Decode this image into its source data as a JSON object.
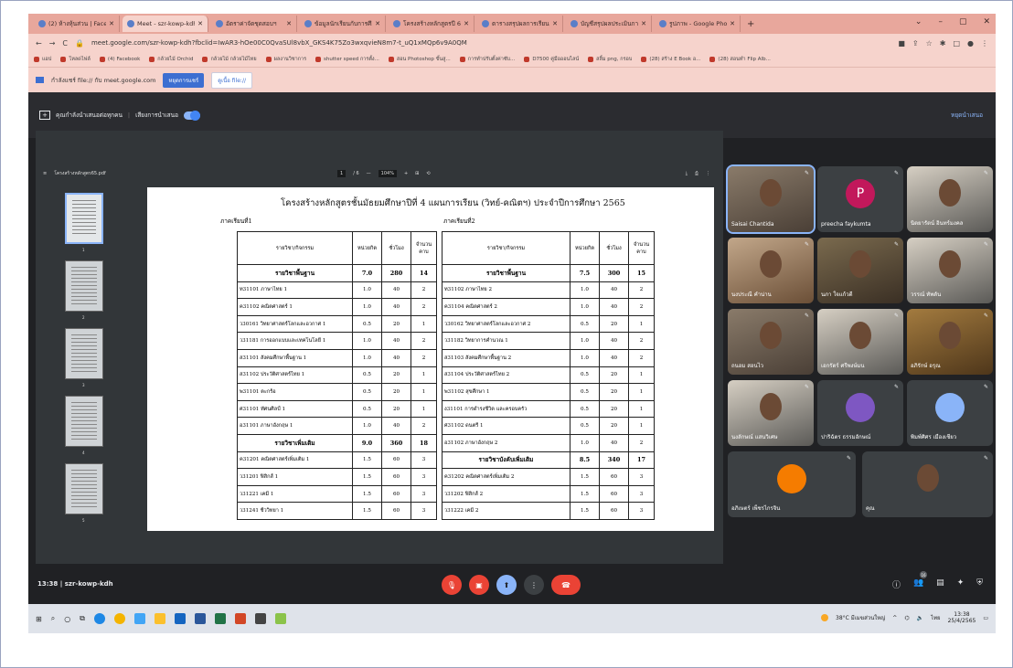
{
  "browser": {
    "tabs": [
      {
        "label": "(2) ห้างหุ้นส่วน | Facebook",
        "icon": "facebook-icon",
        "active": false
      },
      {
        "label": "Meet - szr-kowp-kdh",
        "icon": "meet-icon",
        "active": true
      },
      {
        "label": "อัตราค่าจัดชุดสอบฯ",
        "icon": "chrome-icon",
        "active": false
      },
      {
        "label": "ข้อมูลนักเรียนกับการศึกษา",
        "icon": "chrome-icon",
        "active": false
      },
      {
        "label": "โครงสร้างหลักสูตรปี 65",
        "icon": "chrome-icon",
        "active": false
      },
      {
        "label": "ตารางสรุปผลการเรียน",
        "icon": "chrome-icon",
        "active": false
      },
      {
        "label": "บัญชีสรุปผลประเมินการศึกษา",
        "icon": "chrome-icon",
        "active": false
      },
      {
        "label": "รูปภาพ - Google Photos",
        "icon": "photos-icon",
        "active": false
      }
    ],
    "new_tab": "+",
    "url": "meet.google.com/szr-kowp-kdh?fbclid=IwAR3-hOe00C0QvaSUl8vbX_GKS4K75Zo3wxqvieN8m7-t_uQ1xMQp6v9A0QM",
    "bookmarks": [
      "แอป",
      "โหลดไฟล์",
      "(4) Facebook",
      "กล้วยไม้ Orchid",
      "กล้วยไม้ กล้วยไม้ไทย",
      "ผลงานวิชาการ",
      "shutter speed การตั้ง...",
      "สอน Photoshop ขั้นสู...",
      "การทำปรับตั้งค่าซับ...",
      "D7500 คู่มือออนไลน์",
      "สลิ้ม png, กรอบ",
      "(28) สร้าง E Book อ...",
      "(28) สอนทำ Flip Alb..."
    ],
    "infobar": {
      "text": "กำลังแชร์ file:// กับ meet.google.com",
      "btn_stop": "หยุดการแชร์",
      "btn_switch": "ดูเนื้อ file://"
    }
  },
  "meet": {
    "present_text": "คุณกำลังนำเสนอต่อทุกคน",
    "audio_label": "เสียงการนำเสนอ",
    "stop_present": "หยุดนำเสนอ",
    "meeting_time": "13:38",
    "meeting_code": "szr-kowp-kdh",
    "participant_count": "16"
  },
  "pdf": {
    "filename": "โครงสร้างหลักสูตร65.pdf",
    "page_current": "1",
    "page_total": "/ 6",
    "zoom": "104%",
    "thumb_numbers": [
      "1",
      "2",
      "3",
      "4",
      "5"
    ],
    "title": "โครงสร้างหลักสูตรชั้นมัธยมศึกษาปีที่ 4 แผนการเรียน (วิทย์-คณิตฯ) ประจำปีการศึกษา 2565",
    "sem1_label": "ภาคเรียนที่1",
    "sem2_label": "ภาคเรียนที่2",
    "headers": [
      "รายวิชา/กิจกรรม",
      "หน่วยกิต",
      "ชั่วโมง",
      "จำนวนคาบ"
    ],
    "sem1_rows": [
      [
        "รายวิชาพื้นฐาน",
        "7.0",
        "280",
        "14",
        "group"
      ],
      [
        "ท31101 ภาษาไทย 1",
        "1.0",
        "40",
        "2",
        ""
      ],
      [
        "ค31102 คณิตศาสตร์ 1",
        "1.0",
        "40",
        "2",
        ""
      ],
      [
        "ว30161 วิทยาศาสตร์โลกและอวกาศ 1",
        "0.5",
        "20",
        "1",
        ""
      ],
      [
        "ว31181 การออกแบบและเทคโนโลยี 1",
        "1.0",
        "40",
        "2",
        ""
      ],
      [
        "ส31101 สังคมศึกษาพื้นฐาน 1",
        "1.0",
        "40",
        "2",
        ""
      ],
      [
        "ส31102 ประวัติศาสตร์ไทย 1",
        "0.5",
        "20",
        "1",
        ""
      ],
      [
        "พ31101 ตะกร้อ",
        "0.5",
        "20",
        "1",
        ""
      ],
      [
        "ศ31101 ทัศนศิลป์ 1",
        "0.5",
        "20",
        "1",
        ""
      ],
      [
        "อ31101 ภาษาอังกฤษ 1",
        "1.0",
        "40",
        "2",
        ""
      ],
      [
        "รายวิชาเพิ่มเติม",
        "9.0",
        "360",
        "18",
        "group"
      ],
      [
        "ค31201 คณิตศาสตร์เพิ่มเติม 1",
        "1.5",
        "60",
        "3",
        ""
      ],
      [
        "ว31201 ฟิสิกส์ 1",
        "1.5",
        "60",
        "3",
        ""
      ],
      [
        "ว31221 เคมี 1",
        "1.5",
        "60",
        "3",
        ""
      ],
      [
        "ว31241 ชีววิทยา 1",
        "1.5",
        "60",
        "3",
        ""
      ]
    ],
    "sem2_rows": [
      [
        "รายวิชาพื้นฐาน",
        "7.5",
        "300",
        "15",
        "group"
      ],
      [
        "ท31102 ภาษาไทย 2",
        "1.0",
        "40",
        "2",
        ""
      ],
      [
        "ค31104 คณิตศาสตร์ 2",
        "1.0",
        "40",
        "2",
        ""
      ],
      [
        "ว30162 วิทยาศาสตร์โลกและอวกาศ 2",
        "0.5",
        "20",
        "1",
        ""
      ],
      [
        "ว31182 วิทยาการคำนวณ 1",
        "1.0",
        "40",
        "2",
        ""
      ],
      [
        "ส31103 สังคมศึกษาพื้นฐาน 2",
        "1.0",
        "40",
        "2",
        ""
      ],
      [
        "ส31104 ประวัติศาสตร์ไทย 2",
        "0.5",
        "20",
        "1",
        ""
      ],
      [
        "พ31102 สุขศึกษา 1",
        "0.5",
        "20",
        "1",
        ""
      ],
      [
        "ง31101 การดำรงชีวิต และครอบครัว",
        "0.5",
        "20",
        "1",
        ""
      ],
      [
        "ศ31102 ดนตรี 1",
        "0.5",
        "20",
        "1",
        ""
      ],
      [
        "อ31102 ภาษาอังกฤษ 2",
        "1.0",
        "40",
        "2",
        ""
      ],
      [
        "รายวิชาบังคับเพิ่มเติม",
        "8.5",
        "340",
        "17",
        "group"
      ],
      [
        "ค31202 คณิตศาสตร์เพิ่มเติม 2",
        "1.5",
        "60",
        "3",
        ""
      ],
      [
        "ว31202 ฟิสิกส์ 2",
        "1.5",
        "60",
        "3",
        ""
      ],
      [
        "ว31222 เคมี 2",
        "1.5",
        "60",
        "3",
        ""
      ]
    ]
  },
  "participants": [
    "Saisai Chantida",
    "preecha faykumta",
    "นิตยารัตน์ อินทร์มงคล",
    "นงประณี คำน่าน",
    "นภา ใจแก้วดี",
    "วรรณ์ ทัพดัน",
    "ถนอม สอนไว",
    "เอกรัตร์ ศรีพงษ์มน",
    "อภิรักษ์ อรุณ",
    "นงลักษณ์ แสนวิเศษ",
    "ปาริฉัตร ธรรมอักษณ์",
    "พิมพ์ศิศร เมืองเชียว",
    "อภิเษตร์ เพ็ชรไกรจิน",
    "คุณ"
  ],
  "avatar_letters": {
    "preecha": "P"
  },
  "taskbar": {
    "weather": "38°C มีเมฆส่วนใหญ่",
    "lang": "ไทย",
    "time": "13:38",
    "date": "25/4/2565"
  },
  "colors": {
    "end_call": "#ea4335",
    "accent": "#8ab4f8",
    "avatar_preecha": "#c2185b",
    "avatar_orange": "#f57c00",
    "avatar_purple": "#7e57c2"
  }
}
